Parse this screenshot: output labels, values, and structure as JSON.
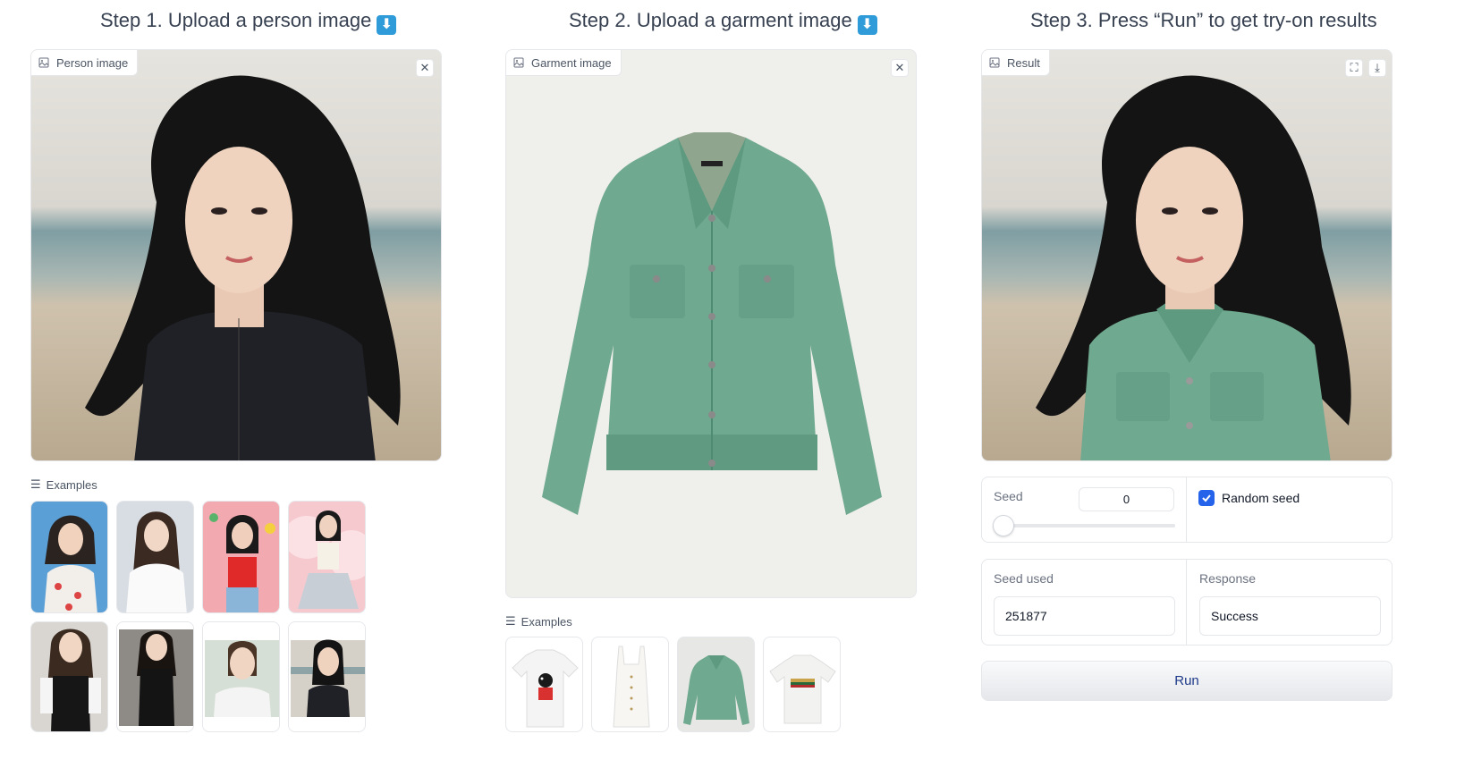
{
  "steps": {
    "step1": "Step 1. Upload a person image",
    "step2": "Step 2. Upload a garment image",
    "step3": "Step 3. Press “Run” to get try-on results",
    "arrow_glyph": "⬇"
  },
  "person_panel": {
    "label": "Person image",
    "close_glyph": "✕"
  },
  "garment_panel": {
    "label": "Garment image",
    "close_glyph": "✕"
  },
  "result_panel": {
    "label": "Result",
    "fullscreen_glyph": "⛶",
    "download_glyph": "⤓"
  },
  "person_examples": {
    "label": "Examples",
    "count": 8
  },
  "garment_examples": {
    "label": "Examples",
    "count": 4
  },
  "controls": {
    "seed_label": "Seed",
    "seed_value": "0",
    "seed_slider_fraction": 0,
    "random_seed_label": "Random seed",
    "random_seed_checked": true,
    "seed_used_label": "Seed used",
    "seed_used_value": "251877",
    "response_label": "Response",
    "response_value": "Success",
    "run_label": "Run"
  },
  "colors": {
    "accent": "#2563eb",
    "jacket": "#6fa98f",
    "person_top": "#1f2126",
    "hair": "#141414",
    "beach_sand": "#c9b9a0",
    "sea": "#7f9ea3"
  }
}
